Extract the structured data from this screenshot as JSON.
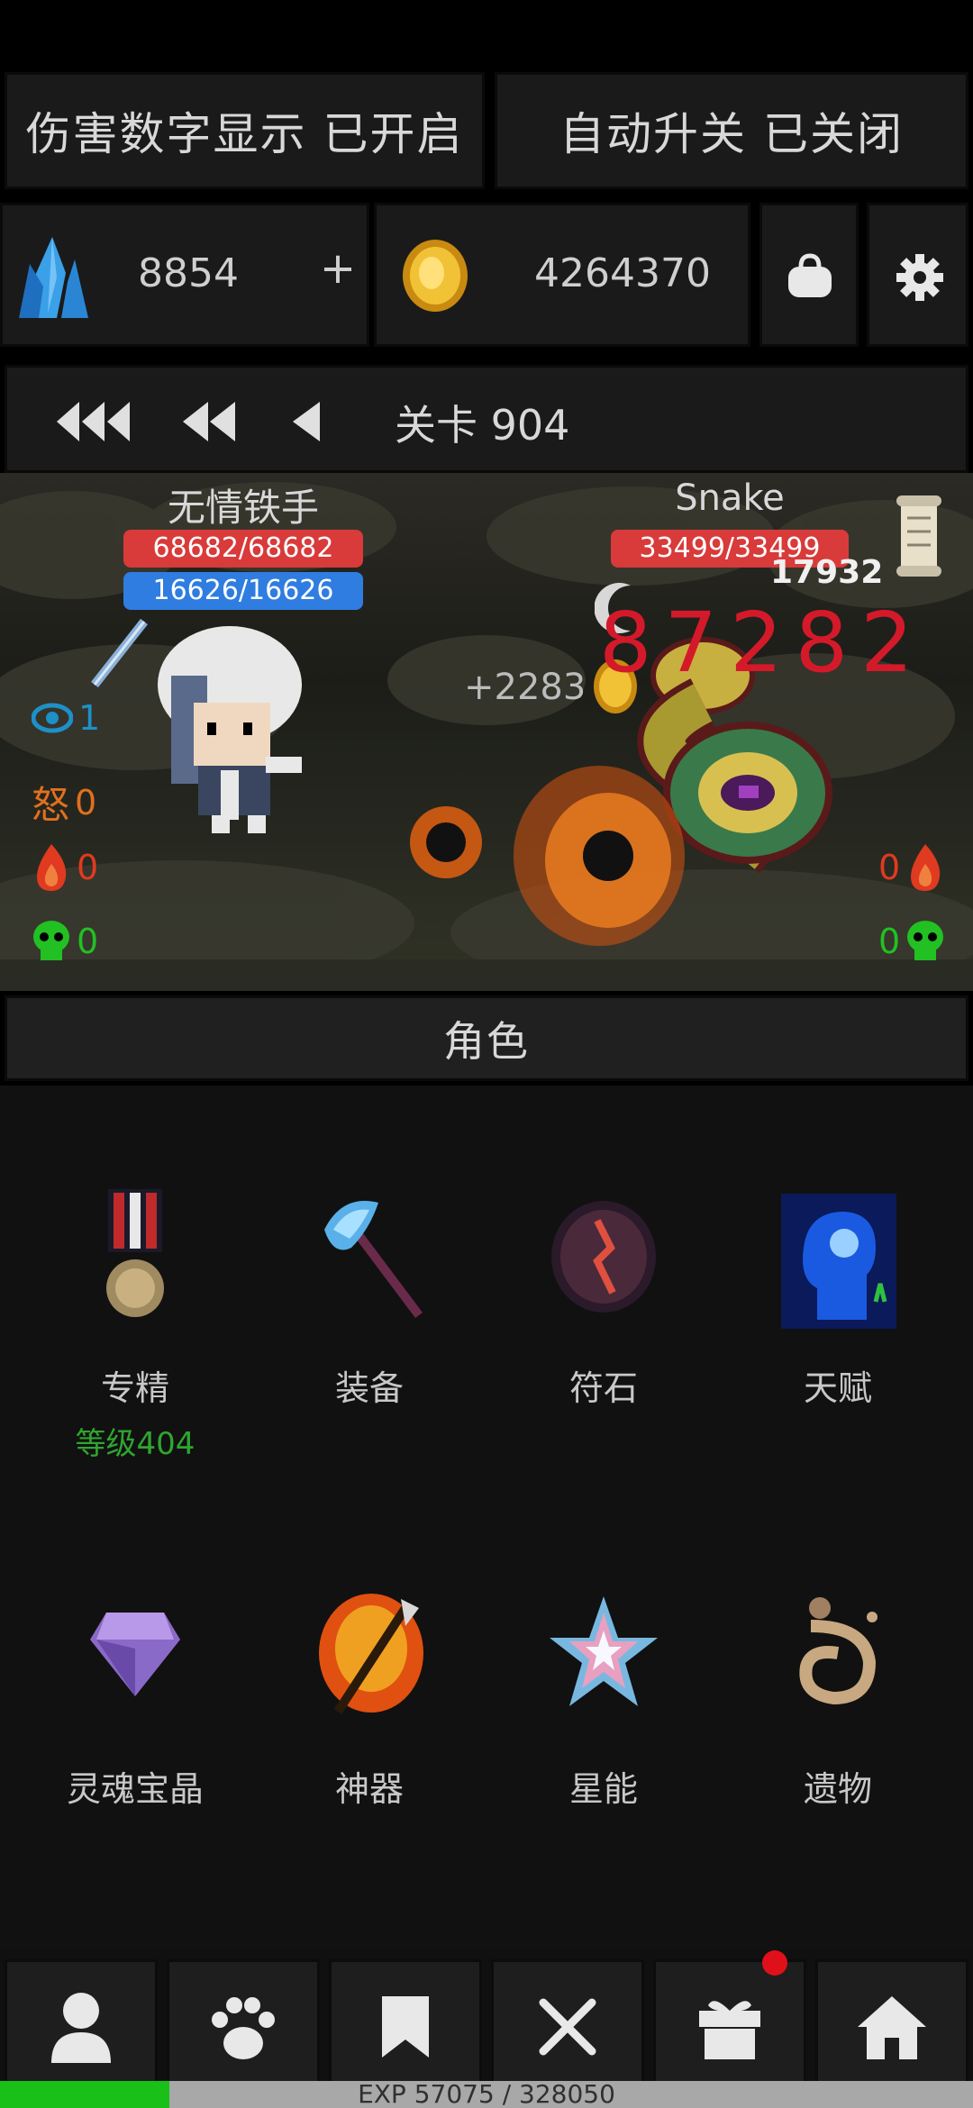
{
  "top_toggles": {
    "damage_numbers": "伤害数字显示 已开启",
    "auto_upgrade": "自动升关 已关闭"
  },
  "resources": {
    "crystals": "8854",
    "crystals_plus": "+",
    "gold": "4264370"
  },
  "stage": {
    "label": "关卡 904"
  },
  "battle": {
    "player": {
      "name": "无情铁手",
      "hp": "68682/68682",
      "mp": "16626/16626",
      "hp_ratio": 1.0,
      "mp_ratio": 1.0
    },
    "enemy": {
      "name": "Snake",
      "hp": "33499/33499",
      "hp_ratio": 1.0
    },
    "floating": {
      "big_damage": "87282",
      "small_damage": "17932",
      "gold_gain": "+2283"
    },
    "player_stats": [
      {
        "icon": "eye-icon",
        "value": "1",
        "color": "#1e90c8"
      },
      {
        "icon": "rage-icon",
        "glyph": "怒",
        "value": "0",
        "color": "#e07020"
      },
      {
        "icon": "fire-icon",
        "value": "0",
        "color": "#e03a20"
      },
      {
        "icon": "skull-icon",
        "value": "0",
        "color": "#22c022"
      }
    ],
    "enemy_stats": [
      {
        "icon": "fire-icon",
        "value": "0"
      },
      {
        "icon": "skull-icon",
        "value": "0"
      }
    ]
  },
  "section_tab": "角色",
  "menu": [
    {
      "icon": "medal-icon",
      "label": "专精",
      "sub": "等级404"
    },
    {
      "icon": "axe-icon",
      "label": "装备"
    },
    {
      "icon": "rune-stone-icon",
      "label": "符石"
    },
    {
      "icon": "talent-head-icon",
      "label": "天赋"
    },
    {
      "icon": "soul-gem-icon",
      "label": "灵魂宝晶"
    },
    {
      "icon": "artifact-icon",
      "label": "神器"
    },
    {
      "icon": "star-energy-icon",
      "label": "星能"
    },
    {
      "icon": "relic-icon",
      "label": "遗物"
    }
  ],
  "nav": [
    "character-tab",
    "pet-tab",
    "bookmark-tab",
    "battle-tab",
    "gift-tab",
    "home-tab"
  ],
  "exp": {
    "text": "EXP 57075 / 328050",
    "ratio": 0.174
  },
  "colors": {
    "hp": "#d93a3a",
    "mp": "#2f7de0",
    "damage": "#d41a2a",
    "level": "#2fa52f",
    "exp_fill": "#18c018",
    "badge": "#e0101a"
  }
}
